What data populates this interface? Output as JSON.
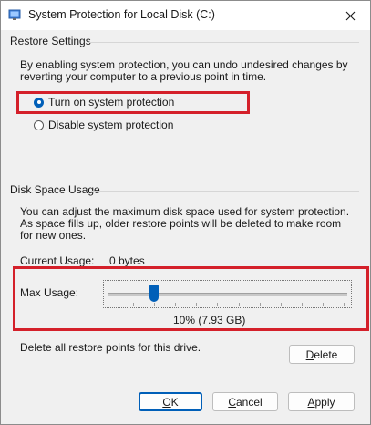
{
  "window": {
    "title": "System Protection for Local Disk (C:)"
  },
  "restore_settings": {
    "heading": "Restore Settings",
    "description": "By enabling system protection, you can undo undesired changes by reverting your computer to a previous point in time.",
    "options": [
      {
        "label": "Turn on system protection",
        "selected": true
      },
      {
        "label": "Disable system protection",
        "selected": false
      }
    ]
  },
  "disk_space": {
    "heading": "Disk Space Usage",
    "description": "You can adjust the maximum disk space used for system protection. As space fills up, older restore points will be deleted to make room for new ones.",
    "current_usage_label": "Current Usage:",
    "current_usage_value": "0 bytes",
    "max_usage_label": "Max Usage:",
    "max_usage_percent": 10,
    "max_usage_text": "10% (7.93 GB)"
  },
  "delete": {
    "text": "Delete all restore points for this drive.",
    "button_label": "Delete"
  },
  "buttons": {
    "ok": "OK",
    "cancel": "Cancel",
    "apply": "Apply"
  },
  "colors": {
    "accent": "#005fb8",
    "highlight": "#d4202a"
  }
}
